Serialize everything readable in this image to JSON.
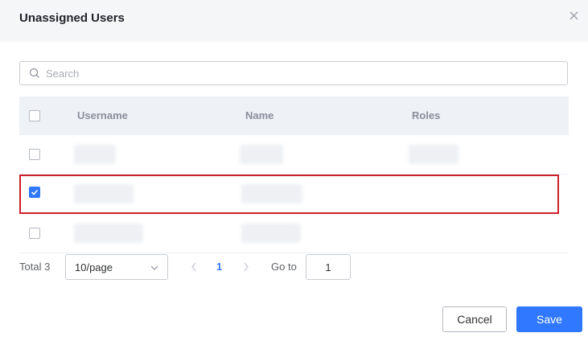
{
  "dialog": {
    "title": "Unassigned Users"
  },
  "search": {
    "placeholder": "Search",
    "value": ""
  },
  "table": {
    "columns": [
      "Username",
      "Name",
      "Roles"
    ],
    "rows": [
      {
        "checked": false,
        "selected": false
      },
      {
        "checked": true,
        "selected": true
      },
      {
        "checked": false,
        "selected": false
      }
    ]
  },
  "pagination": {
    "total_label": "Total 3",
    "page_size": "10/page",
    "current_page": "1",
    "goto_label": "Go to",
    "goto_value": "1"
  },
  "footer": {
    "cancel_label": "Cancel",
    "save_label": "Save"
  },
  "colors": {
    "accent": "#2f78ff",
    "highlight_border": "#cc1f2a",
    "header_bg": "#f5f6f8",
    "table_header_bg": "#eef1f6"
  }
}
